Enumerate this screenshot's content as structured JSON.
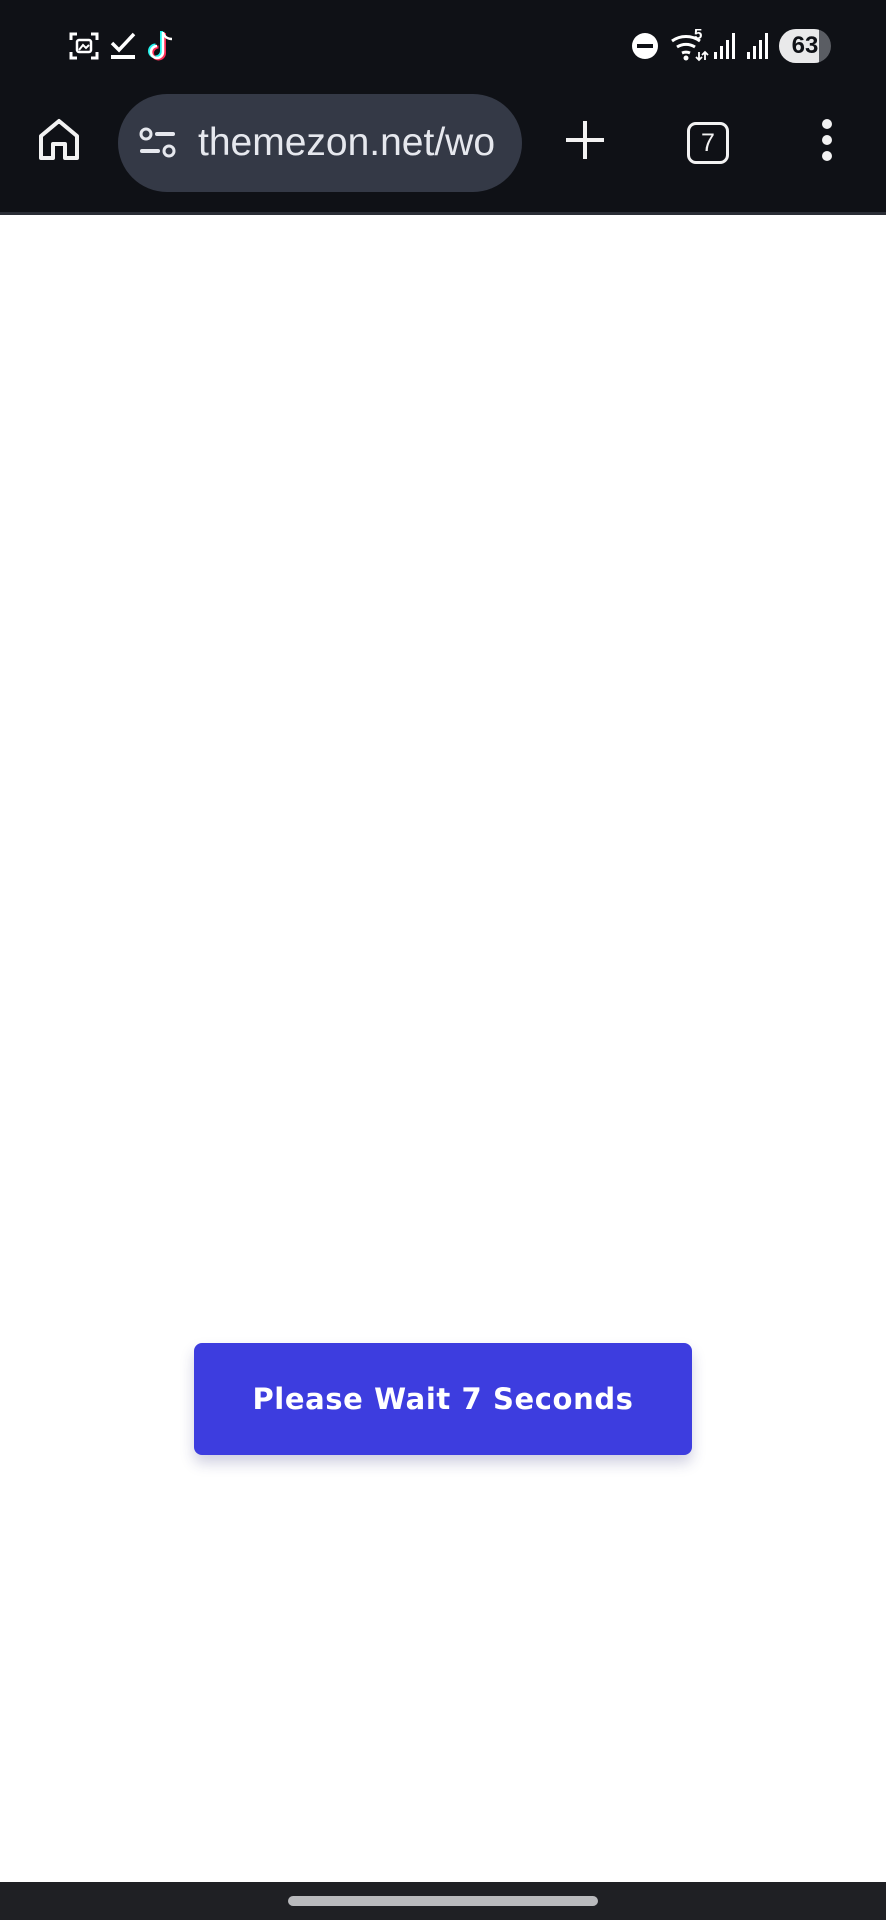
{
  "status_bar": {
    "left_icons": [
      "screenshot-icon",
      "checklist-icon",
      "tiktok-icon"
    ],
    "right_icons": [
      "do-not-disturb-icon",
      "wifi-icon",
      "signal-icon",
      "signal-icon"
    ],
    "wifi_label": "5",
    "battery_level": "63"
  },
  "browser": {
    "url": "themezon.net/wo",
    "tabs_count": "7"
  },
  "page": {
    "wait_button_label": "Please Wait 7 Seconds"
  },
  "colors": {
    "chrome_background": "#0f1116",
    "url_pill": "#343946",
    "button": "#3d3ddf",
    "page_background": "#ffffff"
  }
}
